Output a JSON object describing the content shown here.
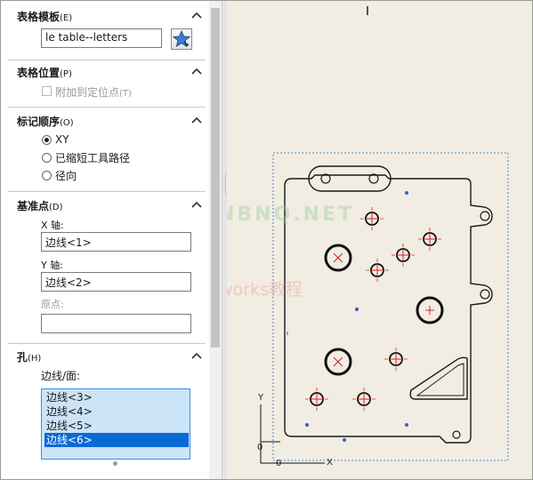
{
  "panel": {
    "table_template": {
      "title": "表格模板",
      "key": "(E)",
      "value": "le table--letters"
    },
    "table_position": {
      "title": "表格位置",
      "key": "(P)",
      "attach_label": "附加到定位点",
      "attach_key": "(T)"
    },
    "tag_order": {
      "title": "标记顺序",
      "key": "(O)",
      "options": [
        "XY",
        "已缩短工具路径",
        "径向"
      ],
      "selected": "XY"
    },
    "datum": {
      "title": "基准点",
      "key": "(D)",
      "x_axis_label": "X 轴:",
      "x_axis_value": "边线<1>",
      "y_axis_label": "Y 轴:",
      "y_axis_value": "边线<2>",
      "origin_label": "原点:",
      "origin_value": ""
    },
    "holes": {
      "title": "孔",
      "key": "(H)",
      "edges_label": "边线/面:",
      "items": [
        "边线<3>",
        "边线<4>",
        "边线<5>",
        "边线<6>"
      ],
      "selected_index": 3
    }
  },
  "graphics": {
    "axis_x_label": "X",
    "axis_y_label": "Y",
    "origin_x_label": "0",
    "origin_y_label": "0",
    "watermark_domain": "NBNQ.NET",
    "watermark_text": "泥老师solidworks教程"
  },
  "colors": {
    "selection_blue": "#0a6ad6",
    "list_bg": "#cce4f7",
    "hole_center_red": "#e02020",
    "bbox_dash": "#4a8ad0"
  },
  "icons": {
    "template_button": "star-icon",
    "collapse": "chevron-up-icon"
  }
}
